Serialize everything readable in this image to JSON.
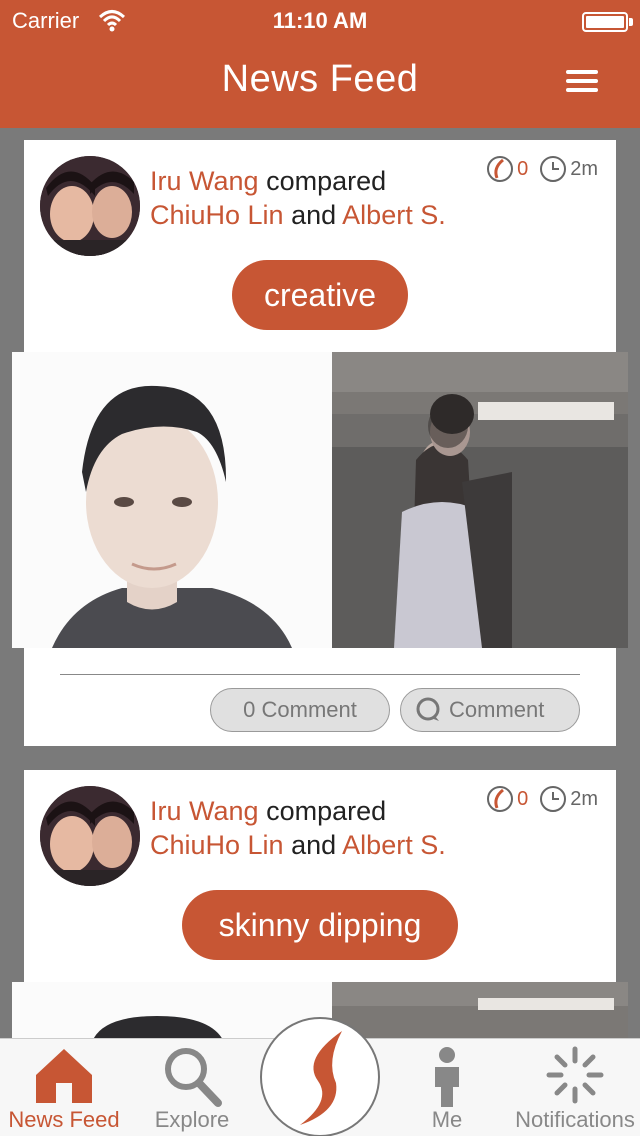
{
  "status_bar": {
    "carrier": "Carrier",
    "time": "11:10 AM"
  },
  "header": {
    "title": "News Feed"
  },
  "posts": [
    {
      "author": "Iru Wang",
      "verb": "compared",
      "subject_a": "ChiuHo Lin",
      "conjunction": "and",
      "subject_b": "Albert S.",
      "votes": "0",
      "time_ago": "2m",
      "tag": "creative",
      "comment_count_label": "0 Comment",
      "comment_button_label": "Comment"
    },
    {
      "author": "Iru Wang",
      "verb": "compared",
      "subject_a": "ChiuHo Lin",
      "conjunction": "and",
      "subject_b": "Albert S.",
      "votes": "0",
      "time_ago": "2m",
      "tag": "skinny dipping"
    }
  ],
  "tabbar": {
    "items": [
      {
        "label": "News Feed",
        "icon": "home-icon",
        "active": true
      },
      {
        "label": "Explore",
        "icon": "search-icon"
      },
      {
        "label": "",
        "icon": "brand-logo-icon"
      },
      {
        "label": "Me",
        "icon": "person-icon"
      },
      {
        "label": "Notifications",
        "icon": "spinner-icon"
      }
    ]
  },
  "colors": {
    "accent": "#c75634",
    "background": "#7a7a7a",
    "pill": "#e0e0e0"
  }
}
